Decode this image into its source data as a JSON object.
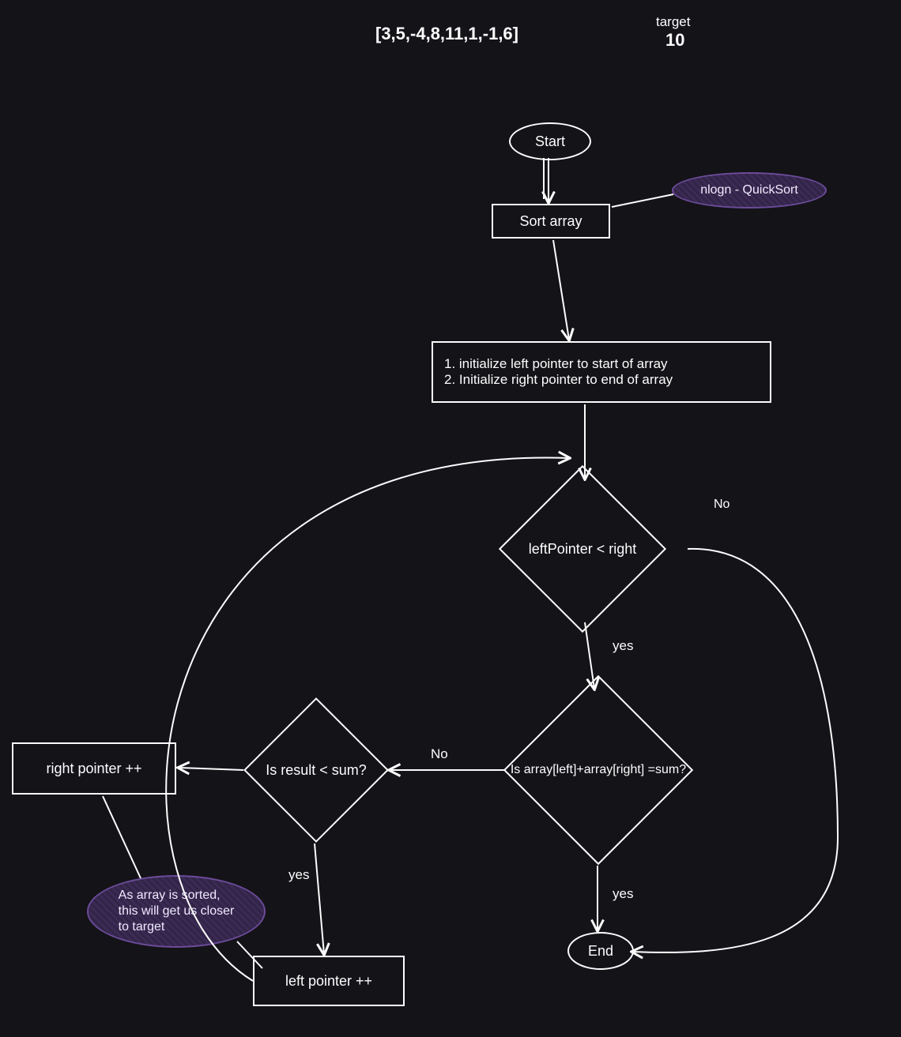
{
  "header": {
    "array_text": "[3,5,-4,8,11,1,-1,6]",
    "target_label": "target",
    "target_value": "10"
  },
  "nodes": {
    "start": "Start",
    "sort": "Sort array",
    "init": "1. initialize left pointer to start of array\n2. Initialize right pointer to end of array",
    "cond_loop": "leftPointer < right",
    "cond_sum": "Is array[left]+array[right] =sum?",
    "cond_result": "Is result < sum?",
    "right_inc": "right pointer ++",
    "left_inc": "left pointer ++",
    "end": "End"
  },
  "edges": {
    "loop_no": "No",
    "loop_yes": "yes",
    "sum_no": "No",
    "sum_yes": "yes",
    "result_yes": "yes"
  },
  "annotations": {
    "sort_note": "nlogn - QuickSort",
    "sorted_note": "As array is sorted,\nthis will get us closer\nto target"
  }
}
